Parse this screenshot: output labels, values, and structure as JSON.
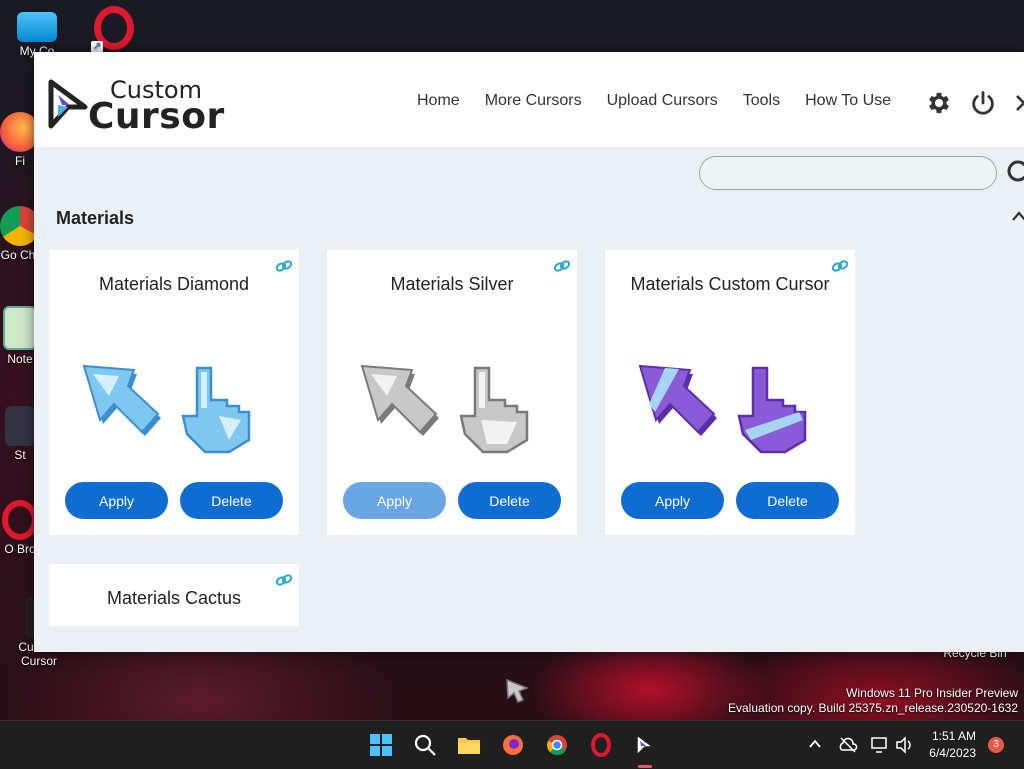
{
  "desktop": {
    "icons": [
      {
        "label": "My Co"
      },
      {
        "label": "Fi"
      },
      {
        "label": "Go Chr"
      },
      {
        "label": "Note"
      },
      {
        "label": "St"
      },
      {
        "label": "O Bro"
      },
      {
        "label": "Custom Cursor"
      }
    ],
    "recycle_bin": "Recycle Bin",
    "watermark_line1": "Windows 11 Pro Insider Preview",
    "watermark_line2": "Evaluation copy. Build 25375.zn_release.230520-1632"
  },
  "app": {
    "logo_line1": "Custom",
    "logo_line2": "Cursor",
    "nav": [
      "Home",
      "More Cursors",
      "Upload Cursors",
      "Tools",
      "How To Use"
    ],
    "search_placeholder": "",
    "section_title": "Materials",
    "cards": [
      {
        "title": "Materials Diamond",
        "apply": "Apply",
        "delete": "Delete",
        "colors": {
          "main": "#7ec8f0",
          "dark": "#3a8fd0",
          "light": "#d4f0ff"
        }
      },
      {
        "title": "Materials Silver",
        "apply": "Apply",
        "delete": "Delete",
        "colors": {
          "main": "#c8c8c8",
          "dark": "#7a7a7a",
          "light": "#f2f2f2"
        }
      },
      {
        "title": "Materials Custom Cursor",
        "apply": "Apply",
        "delete": "Delete",
        "colors": {
          "main": "#8a5ad8",
          "dark": "#5a2fa8",
          "light": "#a8d4f4"
        }
      },
      {
        "title": "Materials Cactus"
      }
    ]
  },
  "taskbar": {
    "time": "1:51 AM",
    "date": "6/4/2023",
    "notification_count": "3"
  }
}
